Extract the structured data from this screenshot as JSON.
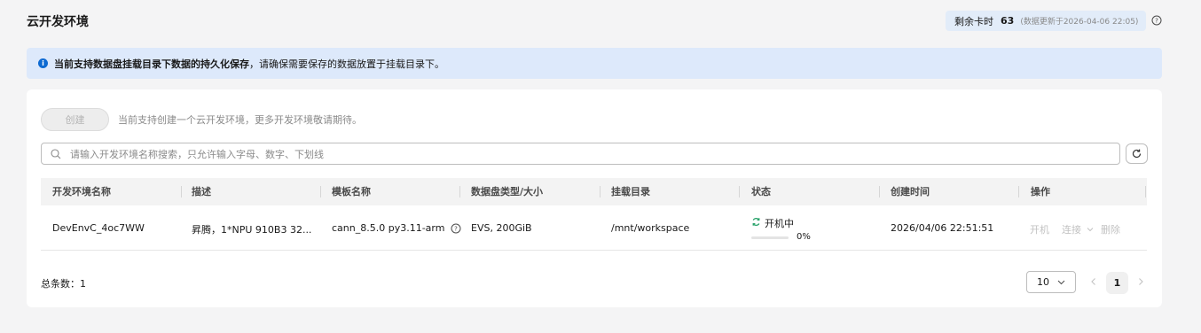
{
  "header": {
    "title": "云开发环境",
    "quota_label": "剩余卡时",
    "quota_value": "63",
    "quota_update": "(数据更新于2026-04-06 22:05)"
  },
  "notice": {
    "bold_text": "当前支持数据盘挂载目录下数据的持久化保存",
    "rest_text": "，请确保需要保存的数据放置于挂载目录下。"
  },
  "toolbar": {
    "create_label": "创建",
    "create_tip": "当前支持创建一个云开发环境，更多开发环境敬请期待。"
  },
  "search": {
    "placeholder": "请输入开发环境名称搜索，只允许输入字母、数字、下划线"
  },
  "table": {
    "columns": [
      "开发环境名称",
      "描述",
      "模板名称",
      "数据盘类型/大小",
      "挂载目录",
      "状态",
      "创建时间",
      "操作"
    ],
    "rows": [
      {
        "name": "DevEnvC_4oc7WW",
        "description": "昇腾，1*NPU 910B3 32...",
        "template": "cann_8.5.0 py3.11-arm",
        "disk": "EVS, 200GiB",
        "mount": "/mnt/workspace",
        "status": "开机中",
        "progress_label": "0%",
        "progress": 0,
        "created": "2026/04/06 22:51:51",
        "actions": {
          "start": "开机",
          "connect": "连接",
          "delete": "删除"
        }
      }
    ]
  },
  "pagination": {
    "total_label": "总条数：",
    "total_value": "1",
    "page_size": "10",
    "current_page": "1"
  },
  "colors": {
    "accent": "#0d6ad2",
    "notice_bg": "#dde9fb",
    "status_green": "#2aa36b"
  }
}
